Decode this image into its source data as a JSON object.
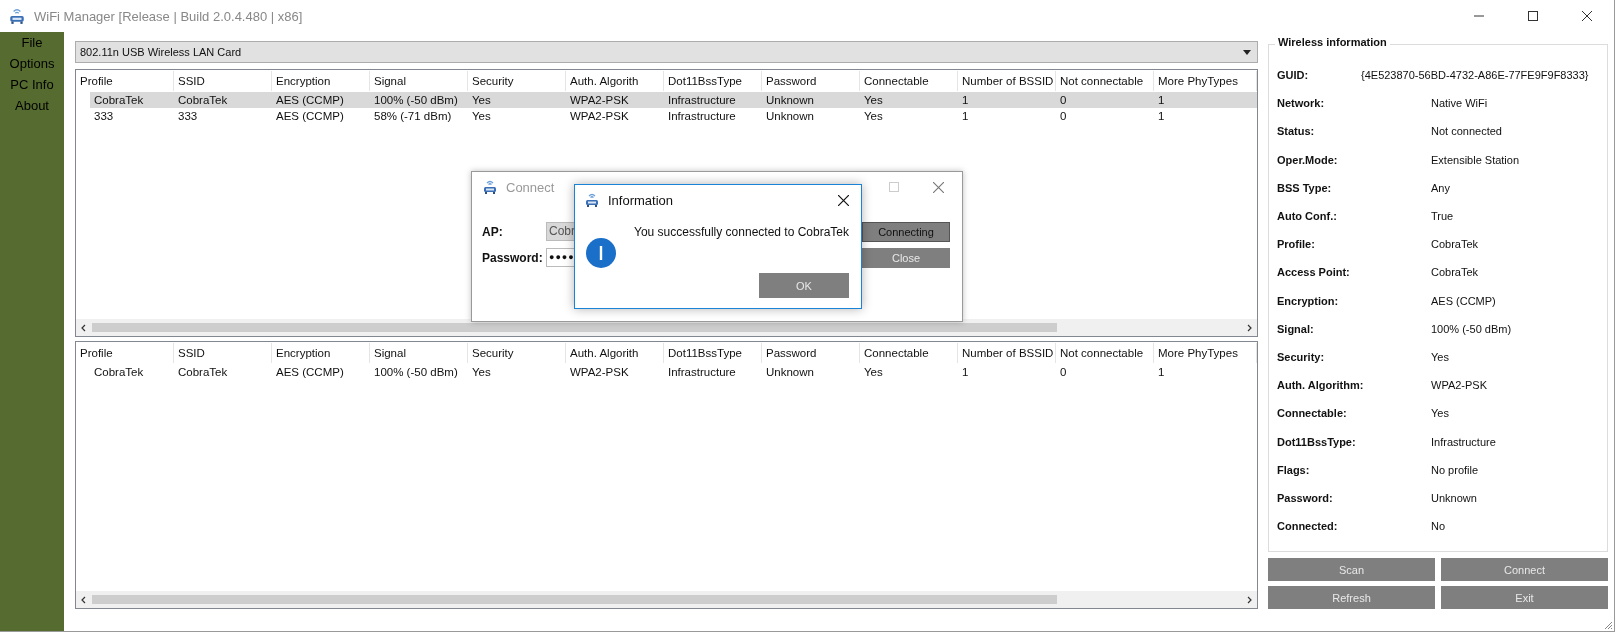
{
  "window": {
    "title": "WiFi Manager [Release | Build 2.0.4.480 | x86]"
  },
  "sidebar": {
    "items": [
      "File",
      "Options",
      "PC Info",
      "About"
    ]
  },
  "adapter_select": {
    "value": "802.11n USB Wireless LAN Card"
  },
  "networks_table": {
    "columns": [
      "Profile",
      "SSID",
      "Encryption",
      "Signal",
      "Security",
      "Auth. Algorith",
      "Dot11BssType",
      "Password",
      "Connectable",
      "Number of BSSID",
      "Not connectable",
      "More PhyTypes"
    ],
    "rows": [
      {
        "selected": true,
        "cells": [
          "CobraTek",
          "CobraTek",
          "AES (CCMP)",
          "100% (-50 dBm)",
          "Yes",
          "WPA2-PSK",
          "Infrastructure",
          "Unknown",
          "Yes",
          "1",
          "0",
          "1"
        ]
      },
      {
        "selected": false,
        "cells": [
          "333",
          "333",
          "AES (CCMP)",
          "58% (-71 dBm)",
          "Yes",
          "WPA2-PSK",
          "Infrastructure",
          "Unknown",
          "Yes",
          "1",
          "0",
          "1"
        ]
      }
    ]
  },
  "connected_table": {
    "columns": [
      "Profile",
      "SSID",
      "Encryption",
      "Signal",
      "Security",
      "Auth. Algorith",
      "Dot11BssType",
      "Password",
      "Connectable",
      "Number of BSSID",
      "Not connectable",
      "More PhyTypes"
    ],
    "rows": [
      {
        "selected": false,
        "cells": [
          "CobraTek",
          "CobraTek",
          "AES (CCMP)",
          "100% (-50 dBm)",
          "Yes",
          "WPA2-PSK",
          "Infrastructure",
          "Unknown",
          "Yes",
          "1",
          "0",
          "1"
        ]
      }
    ]
  },
  "wireless_information": {
    "title": "Wireless information",
    "fields": [
      {
        "kind": "id",
        "label": "GUID:",
        "value": "{4E523870-56BD-4732-A86E-77FE9F9F8333}"
      },
      {
        "kind": "text",
        "label": "Network:",
        "value": "Native WiFi"
      },
      {
        "kind": "text",
        "label": "Status:",
        "value": "Not connected"
      },
      {
        "kind": "text",
        "label": "Oper.Mode:",
        "value": "Extensible Station"
      },
      {
        "kind": "text",
        "label": "BSS Type:",
        "value": "Any"
      },
      {
        "kind": "text",
        "label": "Auto Conf.:",
        "value": "True"
      },
      {
        "kind": "text",
        "label": "Profile:",
        "value": "CobraTek"
      },
      {
        "kind": "text",
        "label": "Access Point:",
        "value": "CobraTek"
      },
      {
        "kind": "text",
        "label": "Encryption:",
        "value": "AES (CCMP)"
      },
      {
        "kind": "text",
        "label": "Signal:",
        "value": "100% (-50 dBm)"
      },
      {
        "kind": "text",
        "label": "Security:",
        "value": "Yes"
      },
      {
        "kind": "text",
        "label": "Auth. Algorithm:",
        "value": "WPA2-PSK"
      },
      {
        "kind": "text",
        "label": "Connectable:",
        "value": "Yes"
      },
      {
        "kind": "text",
        "label": "Dot11BssType:",
        "value": "Infrastructure"
      },
      {
        "kind": "text",
        "label": "Flags:",
        "value": "No profile"
      },
      {
        "kind": "text",
        "label": "Password:",
        "value": "Unknown"
      },
      {
        "kind": "text",
        "label": "Connected:",
        "value": "No"
      }
    ]
  },
  "buttons": [
    "Scan",
    "Connect",
    "Refresh",
    "Exit"
  ],
  "connect_dialog": {
    "title": "Connect",
    "fields": [
      {
        "kind": "readonly",
        "label": "AP:",
        "value": "Cobr"
      },
      {
        "kind": "password",
        "label": "Password:",
        "value": "●●●●"
      }
    ],
    "buttons": [
      "Connecting",
      "Close"
    ]
  },
  "information_dialog": {
    "title": "Information",
    "message": "You successfully connected to CobraTek",
    "button": "OK"
  }
}
